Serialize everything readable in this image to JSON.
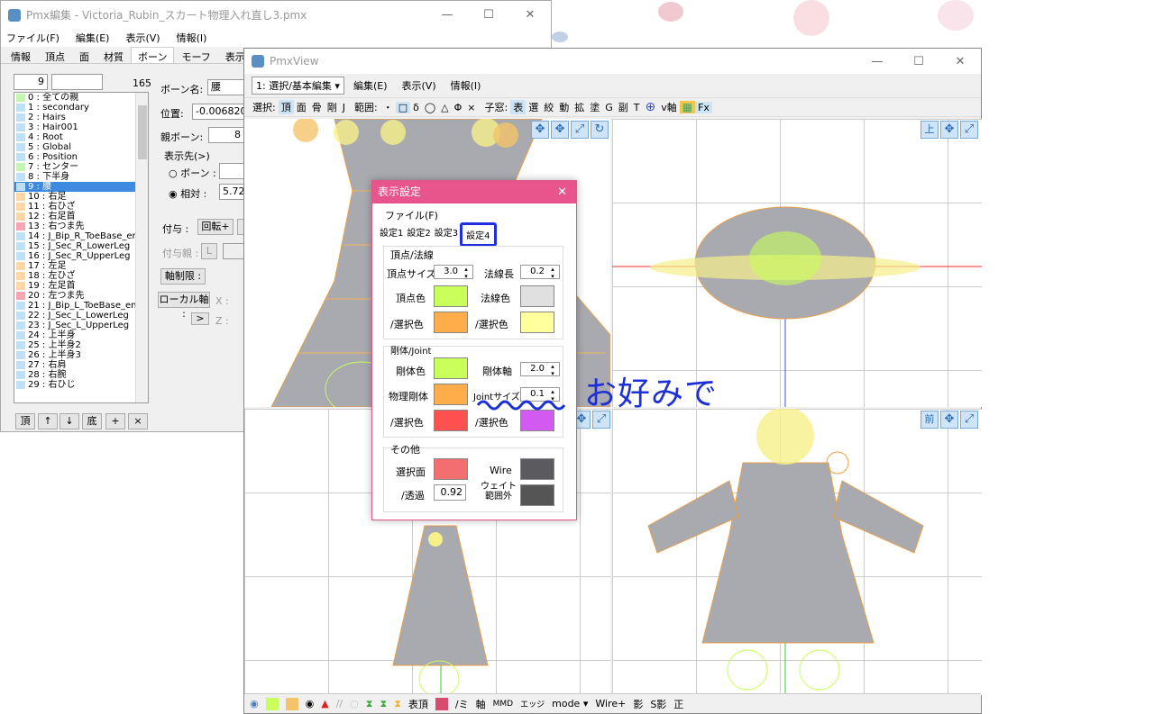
{
  "editor": {
    "title": "Pmx編集 - Victoria_Rubin_スカート物理入れ直し3.pmx",
    "menu": [
      "ファイル(F)",
      "編集(E)",
      "表示(V)",
      "情報(I)"
    ],
    "tabs": [
      "情報",
      "頂点",
      "面",
      "材質",
      "ボーン",
      "モーフ",
      "表示"
    ],
    "index_value": "9",
    "count": "165",
    "bones": [
      {
        "label": "0 : 全ての親",
        "color": "#c6f5b2"
      },
      {
        "label": "1 : secondary",
        "color": "#bfe0f7"
      },
      {
        "label": "2 : Hairs",
        "color": "#bfe0f7"
      },
      {
        "label": "3 : Hair001",
        "color": "#bfe0f7"
      },
      {
        "label": "4 : Root",
        "color": "#bfe0f7"
      },
      {
        "label": "5 : Global",
        "color": "#bfe0f7"
      },
      {
        "label": "6 : Position",
        "color": "#bfe0f7"
      },
      {
        "label": "7 : センター",
        "color": "#c6f5b2"
      },
      {
        "label": "8 : 下半身",
        "color": "#bfe0f7"
      },
      {
        "label": "9 : 腰",
        "color": "#bfe0f7",
        "selected": true
      },
      {
        "label": "10 : 右足",
        "color": "#ffd7a6"
      },
      {
        "label": "11 : 右ひざ",
        "color": "#ffd7a6"
      },
      {
        "label": "12 : 右足首",
        "color": "#ffd7a6"
      },
      {
        "label": "13 : 右つま先",
        "color": "#f5a6b2"
      },
      {
        "label": "14 : J_Bip_R_ToeBase_en",
        "color": "#bfe0f7"
      },
      {
        "label": "15 : J_Sec_R_LowerLeg",
        "color": "#bfe0f7"
      },
      {
        "label": "16 : J_Sec_R_UpperLeg",
        "color": "#bfe0f7"
      },
      {
        "label": "17 : 左足",
        "color": "#ffd7a6"
      },
      {
        "label": "18 : 左ひざ",
        "color": "#ffd7a6"
      },
      {
        "label": "19 : 左足首",
        "color": "#ffd7a6"
      },
      {
        "label": "20 : 左つま先",
        "color": "#f5a6b2"
      },
      {
        "label": "21 : J_Bip_L_ToeBase_en",
        "color": "#bfe0f7"
      },
      {
        "label": "22 : J_Sec_L_LowerLeg",
        "color": "#bfe0f7"
      },
      {
        "label": "23 : J_Sec_L_UpperLeg",
        "color": "#bfe0f7"
      },
      {
        "label": "24 : 上半身",
        "color": "#bfe0f7"
      },
      {
        "label": "25 : 上半身2",
        "color": "#bfe0f7"
      },
      {
        "label": "26 : 上半身3",
        "color": "#bfe0f7"
      },
      {
        "label": "27 : 右肩",
        "color": "#bfe0f7"
      },
      {
        "label": "28 : 右腕",
        "color": "#bfe0f7"
      },
      {
        "label": "29 : 右ひじ",
        "color": "#bfe0f7"
      }
    ],
    "list_buttons": [
      "頂",
      "↑",
      "↓",
      "底",
      "+",
      "×"
    ],
    "props": {
      "bone_name_label": "ボーン名:",
      "bone_name": "腰",
      "position_label": "位置:",
      "position": "-0.006820",
      "parent_label": "親ボーン:",
      "parent_value": "8",
      "display_label": "表示先(>)",
      "bone_radio": "ボーン :",
      "relative_radio": "相対 :",
      "relative_value": "5.722",
      "fuyo_label": "付与 :",
      "rot_btn": "回転+",
      "fuyo_parent": "付与親 :",
      "fuyo_l": "L",
      "axis_limit": "軸制限 :",
      "local_axis": "ローカル軸 :",
      "x": "X :",
      "z": "Z :",
      "next": ">"
    }
  },
  "viewer": {
    "title": "PmxView",
    "mode_select": "1: 選択/基本編集",
    "menu": [
      "編集(E)",
      "表示(V)",
      "情報(I)"
    ],
    "toolbar_select": "選択:",
    "toolbar_items": [
      "頂",
      "面",
      "骨",
      "剛",
      "J"
    ],
    "range_label": "範囲:",
    "range_items": [
      "・",
      "□",
      "δ",
      "◯",
      "△",
      "Φ",
      "×"
    ],
    "child_label": "子窓:",
    "child_items": [
      "表",
      "選",
      "絞",
      "動",
      "拡",
      "塗",
      "G",
      "副",
      "T"
    ],
    "v_axis": "v軸",
    "fx": "Fx",
    "view_top": "上",
    "view_front": "前",
    "status": [
      "表頂",
      "/ミ",
      "軸",
      "MMD",
      "エッジ",
      "mode ▾",
      "Wire+",
      "影",
      "S影",
      "正"
    ]
  },
  "dialog": {
    "title": "表示設定",
    "menu_file": "ファイル(F)",
    "tabs": [
      "設定1",
      "設定2",
      "設定3",
      "設定4"
    ],
    "active_tab": "設定4",
    "vertex_group": "頂点/法線",
    "vertex_size_label": "頂点サイズ",
    "vertex_size": "3.0",
    "normal_length_label": "法線長",
    "normal_length": "0.2",
    "vertex_color_label": "頂点色",
    "vertex_color": "#c8ff5a",
    "normal_color_label": "法線色",
    "normal_color": "#e0e0e0",
    "vertex_sel_label": "/選択色",
    "vertex_sel_color": "#ffad4a",
    "normal_sel_label": "/選択色",
    "normal_sel_color": "#ffff9e",
    "rigid_group": "剛体/Joint",
    "rigid_color_label": "剛体色",
    "rigid_color": "#c8ff5a",
    "rigid_axis_label": "剛体軸",
    "rigid_axis": "2.0",
    "physics_rigid_label": "物理剛体",
    "physics_rigid_color": "#ffad4a",
    "joint_size_label": "Jointサイズ",
    "joint_size": "0.1",
    "rigid_sel_label": "/選択色",
    "rigid_sel_color": "#ff5050",
    "joint_sel_label": "/選択色",
    "joint_sel_color": "#d25af0",
    "other_group": "その他",
    "sel_face_label": "選択面",
    "sel_face_color": "#f36e6e",
    "wire_label": "Wire",
    "wire_color": "#5a5a5f",
    "alpha_label": "/透過",
    "alpha": "0.92",
    "weight_label": "ウェイト\n範囲外",
    "weight_color": "#555555"
  },
  "annotation": "お好みで"
}
